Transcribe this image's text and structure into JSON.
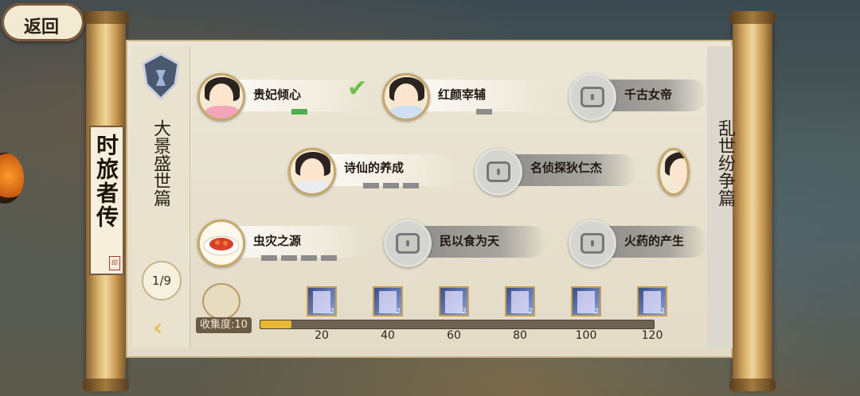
{
  "nav": {
    "back_label": "返回"
  },
  "side_title": "时旅者传",
  "chapter": {
    "title": "大景盛世篇",
    "page": "1/9"
  },
  "next_chapter_partial": "乱世纷争篇",
  "nodes": [
    {
      "label": "贵妃倾心",
      "state": "completed",
      "progress_total": 1,
      "progress_done": 1
    },
    {
      "label": "红颜宰辅",
      "state": "unlocked",
      "progress_total": 1,
      "progress_done": 0
    },
    {
      "label": "千古女帝",
      "state": "locked"
    },
    {
      "label": "诗仙的养成",
      "state": "unlocked",
      "progress_total": 3,
      "progress_done": 0
    },
    {
      "label": "名侦探狄仁杰",
      "state": "locked"
    },
    {
      "label": "虫灾之源",
      "state": "unlocked",
      "progress_total": 4,
      "progress_done": 0
    },
    {
      "label": "民以食为天",
      "state": "locked"
    },
    {
      "label": "火药的产生",
      "state": "locked"
    }
  ],
  "collection": {
    "label": "收集度:10",
    "value": 10,
    "max": 120,
    "milestones": [
      "20",
      "40",
      "60",
      "80",
      "100",
      "120"
    ],
    "reward_qty": "2"
  },
  "colors": {
    "progress_done": "#4caf50",
    "collection_fill": "#e8b830",
    "check": "#6fc04a"
  }
}
